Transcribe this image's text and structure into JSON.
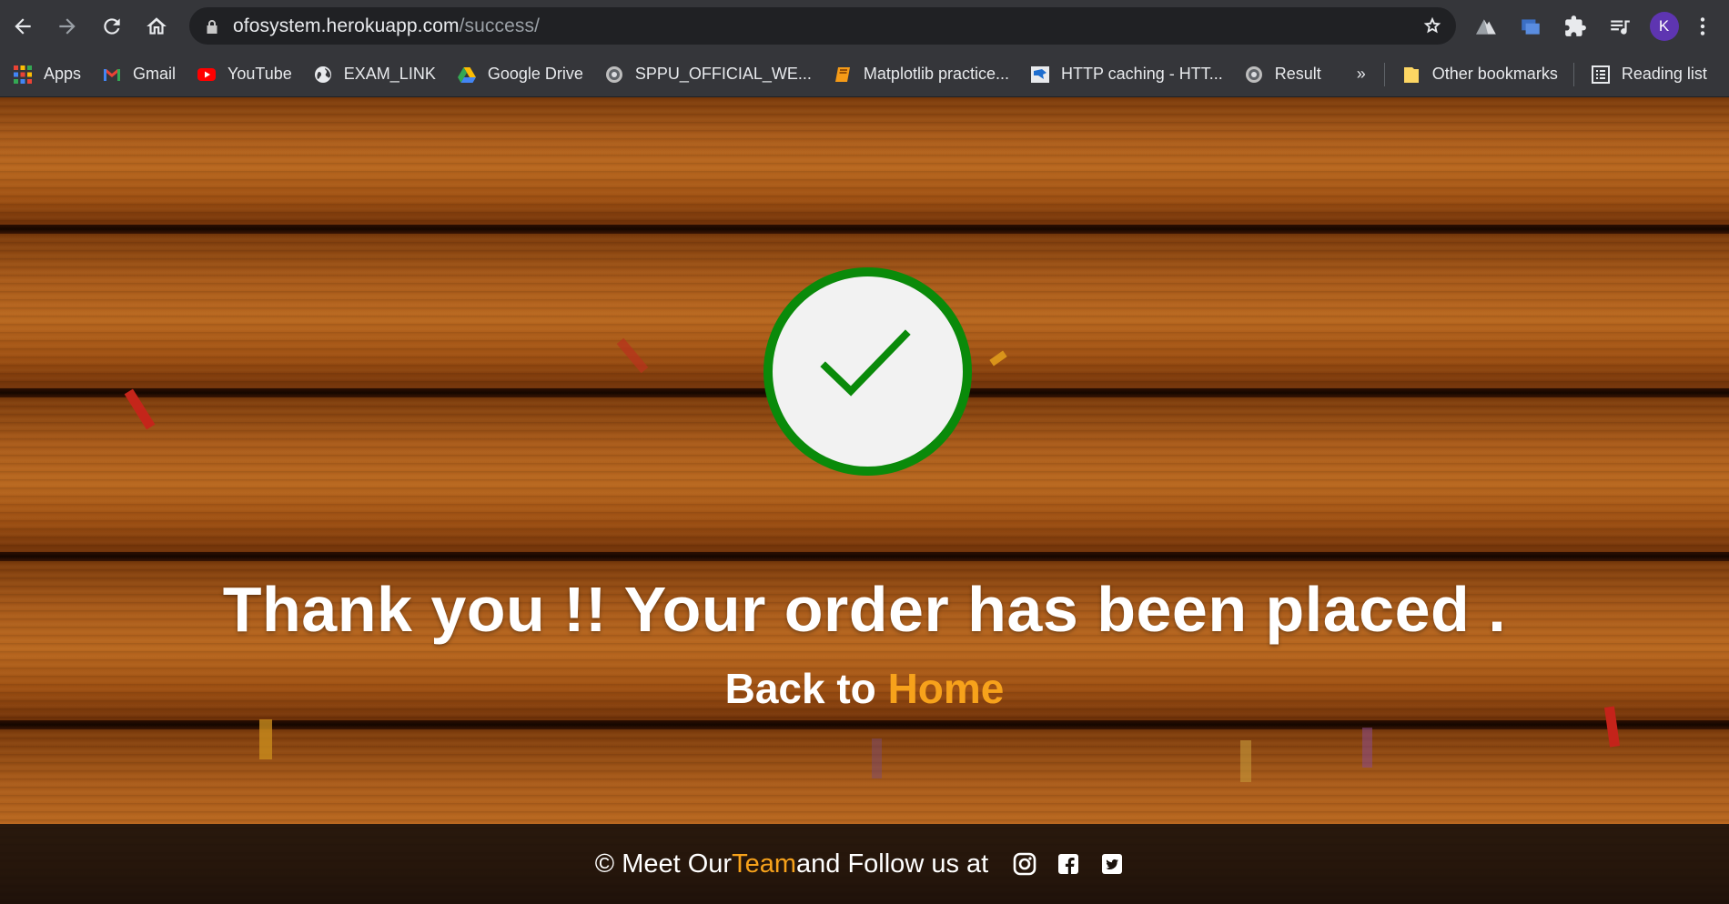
{
  "browser": {
    "url_host": "ofosystem.herokuapp.com",
    "url_path": "/success/",
    "profile_initial": "K"
  },
  "bookmarks": [
    {
      "label": "Apps",
      "icon": "apps-grid-icon"
    },
    {
      "label": "Gmail",
      "icon": "gmail-icon"
    },
    {
      "label": "YouTube",
      "icon": "youtube-icon"
    },
    {
      "label": "EXAM_LINK",
      "icon": "globe-icon"
    },
    {
      "label": "Google Drive",
      "icon": "google-drive-icon"
    },
    {
      "label": "SPPU_OFFICIAL_WE...",
      "icon": "sppu-emblem-icon"
    },
    {
      "label": "Matplotlib practice...",
      "icon": "notebook-icon"
    },
    {
      "label": "HTTP caching - HTT...",
      "icon": "mdn-icon"
    },
    {
      "label": "Result",
      "icon": "sppu-emblem-icon"
    }
  ],
  "bookmarks_overflow": "»",
  "other_bookmarks": "Other bookmarks",
  "reading_list": "Reading list",
  "page": {
    "headline": "Thank you !! Your order has been placed .",
    "back_prefix": "Back to ",
    "back_link": "Home",
    "footer_prefix": "© Meet Our ",
    "footer_team": "Team",
    "footer_suffix": " and Follow us at",
    "social": [
      "instagram-icon",
      "facebook-icon",
      "twitter-icon"
    ]
  },
  "colors": {
    "accent": "#f7a21b",
    "check_green": "#0a8a0a"
  }
}
